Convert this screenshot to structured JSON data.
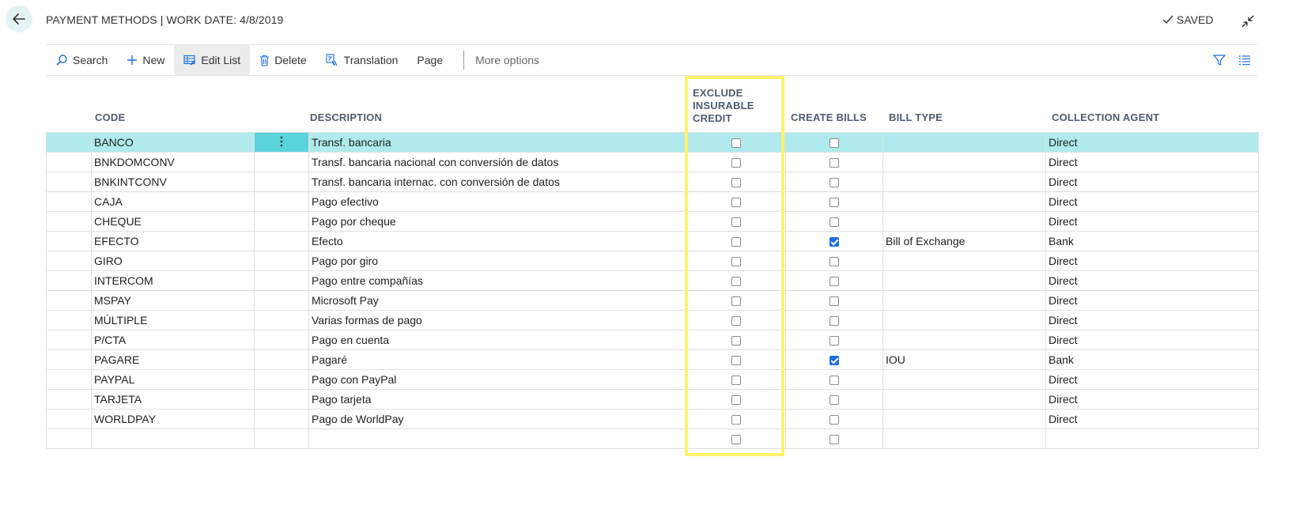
{
  "header": {
    "title": "PAYMENT METHODS | WORK DATE: 4/8/2019",
    "saved_label": "SAVED"
  },
  "toolbar": {
    "search": "Search",
    "new": "New",
    "edit_list": "Edit List",
    "delete": "Delete",
    "translation": "Translation",
    "page": "Page",
    "more_options": "More options"
  },
  "columns": {
    "code": "CODE",
    "description": "DESCRIPTION",
    "exclude_line1": "EXCLUDE",
    "exclude_line2": "INSURABLE",
    "exclude_line3": "CREDIT",
    "create_bills": "CREATE BILLS",
    "bill_type": "BILL TYPE",
    "collection_agent": "COLLECTION AGENT"
  },
  "rows": [
    {
      "code": "BANCO",
      "description": "Transf. bancaria",
      "exclude": false,
      "create_bills": false,
      "bill_type": "",
      "collection_agent": "Direct",
      "selected": true
    },
    {
      "code": "BNKDOMCONV",
      "description": "Transf. bancaria nacional con conversión de datos",
      "exclude": false,
      "create_bills": false,
      "bill_type": "",
      "collection_agent": "Direct"
    },
    {
      "code": "BNKINTCONV",
      "description": "Transf. bancaria internac. con conversión de datos",
      "exclude": false,
      "create_bills": false,
      "bill_type": "",
      "collection_agent": "Direct"
    },
    {
      "code": "CAJA",
      "description": "Pago efectivo",
      "exclude": false,
      "create_bills": false,
      "bill_type": "",
      "collection_agent": "Direct"
    },
    {
      "code": "CHEQUE",
      "description": "Pago por cheque",
      "exclude": false,
      "create_bills": false,
      "bill_type": "",
      "collection_agent": "Direct"
    },
    {
      "code": "EFECTO",
      "description": "Efecto",
      "exclude": false,
      "create_bills": true,
      "bill_type": "Bill of Exchange",
      "collection_agent": "Bank"
    },
    {
      "code": "GIRO",
      "description": "Pago por giro",
      "exclude": false,
      "create_bills": false,
      "bill_type": "",
      "collection_agent": "Direct"
    },
    {
      "code": "INTERCOM",
      "description": "Pago entre compañías",
      "exclude": false,
      "create_bills": false,
      "bill_type": "",
      "collection_agent": "Direct"
    },
    {
      "code": "MSPAY",
      "description": "Microsoft Pay",
      "exclude": false,
      "create_bills": false,
      "bill_type": "",
      "collection_agent": "Direct"
    },
    {
      "code": "MÚLTIPLE",
      "description": "Varias formas de pago",
      "exclude": false,
      "create_bills": false,
      "bill_type": "",
      "collection_agent": "Direct"
    },
    {
      "code": "P/CTA",
      "description": "Pago en cuenta",
      "exclude": false,
      "create_bills": false,
      "bill_type": "",
      "collection_agent": "Direct"
    },
    {
      "code": "PAGARE",
      "description": "Pagaré",
      "exclude": false,
      "create_bills": true,
      "bill_type": "IOU",
      "collection_agent": "Bank"
    },
    {
      "code": "PAYPAL",
      "description": "Pago con PayPal",
      "exclude": false,
      "create_bills": false,
      "bill_type": "",
      "collection_agent": "Direct"
    },
    {
      "code": "TARJETA",
      "description": "Pago tarjeta",
      "exclude": false,
      "create_bills": false,
      "bill_type": "",
      "collection_agent": "Direct"
    },
    {
      "code": "WORLDPAY",
      "description": "Pago de WorldPay",
      "exclude": false,
      "create_bills": false,
      "bill_type": "",
      "collection_agent": "Direct"
    },
    {
      "code": "",
      "description": "",
      "exclude": false,
      "create_bills": false,
      "bill_type": "",
      "collection_agent": ""
    }
  ],
  "colors": {
    "selected_row": "#b0eaec",
    "row_menu": "#5ad3db",
    "highlight": "#fff36b",
    "accent": "#1f6fe0"
  }
}
